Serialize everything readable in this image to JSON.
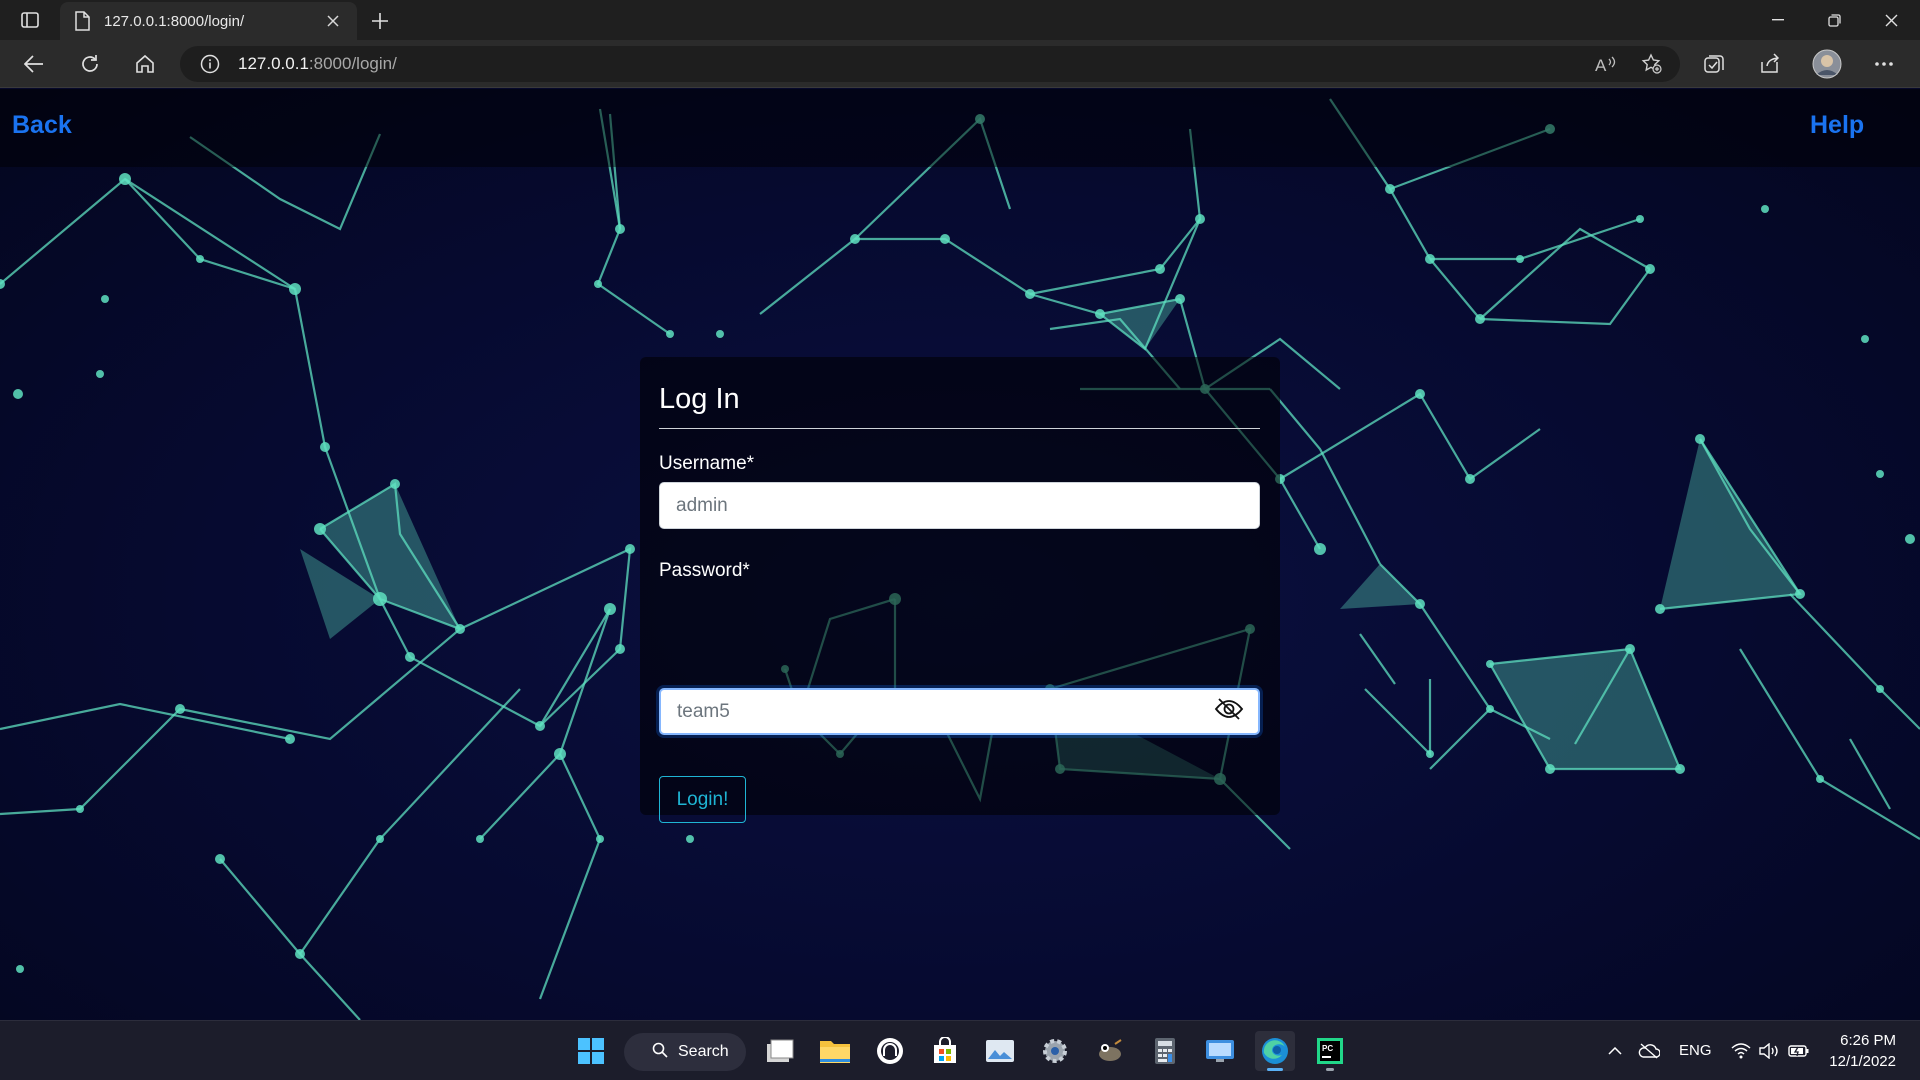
{
  "browser": {
    "tab_title": "127.0.0.1:8000/login/",
    "url_host": "127.0.0.1",
    "url_rest": ":8000/login/"
  },
  "nav": {
    "back_label": "Back",
    "help_label": "Help"
  },
  "login": {
    "title": "Log In",
    "username_label": "Username*",
    "username_value": "admin",
    "password_label": "Password*",
    "password_value": "team5",
    "submit_label": "Login!"
  },
  "taskbar": {
    "search_label": "Search",
    "language": "ENG",
    "time": "6:26 PM",
    "date": "12/1/2022"
  },
  "colors": {
    "link": "#1a73f0",
    "network_line": "#5fe0c0",
    "button_accent": "#1fb5d4"
  }
}
